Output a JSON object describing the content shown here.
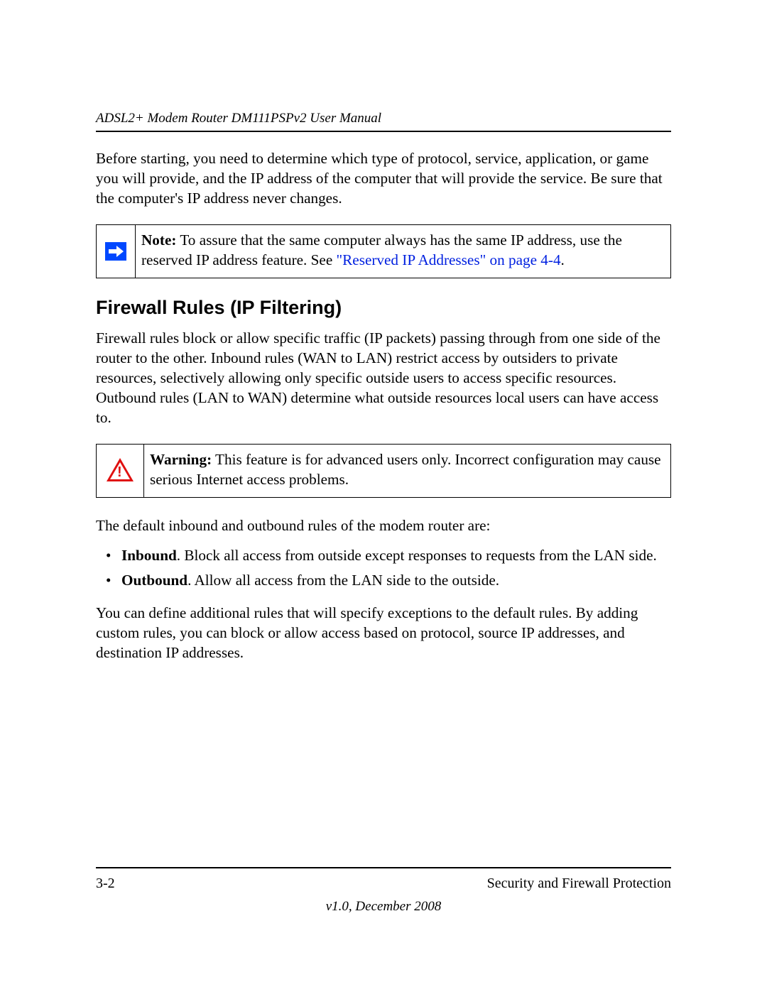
{
  "header": {
    "doc_title": "ADSL2+ Modem Router DM111PSPv2 User Manual"
  },
  "intro": {
    "para": "Before starting, you need to determine which type of protocol, service, application, or game you will provide, and the IP address of the computer that will provide the service. Be sure that the computer's IP address never changes."
  },
  "note": {
    "label": "Note:",
    "text_before_link": " To assure that the same computer always has the same IP address, use the reserved IP address feature. See ",
    "link_text": "\"Reserved IP Addresses\" on page 4-4",
    "text_after_link": "."
  },
  "section": {
    "heading": "Firewall Rules (IP Filtering)",
    "para1": "Firewall rules block or allow specific traffic (IP packets) passing through from one side of the router to the other. Inbound rules (WAN to LAN) restrict access by outsiders to private resources, selectively allowing only specific outside users to access specific resources. Outbound rules (LAN to WAN) determine what outside resources local users can have access to."
  },
  "warning": {
    "label": "Warning:",
    "text": " This feature is for advanced users only. Incorrect configuration may cause serious Internet access problems."
  },
  "rules": {
    "intro": "The default inbound and outbound rules of the modem router are:",
    "items": [
      {
        "label": "Inbound",
        "text": ". Block all access from outside except responses to requests from the LAN side."
      },
      {
        "label": "Outbound",
        "text": ". Allow all access from the LAN side to the outside."
      }
    ],
    "outro": "You can define additional rules that will specify exceptions to the default rules. By adding custom rules, you can block or allow access based on protocol, source IP addresses, and destination IP addresses."
  },
  "footer": {
    "page_num": "3-2",
    "chapter": "Security and Firewall Protection",
    "version": "v1.0, December 2008"
  }
}
